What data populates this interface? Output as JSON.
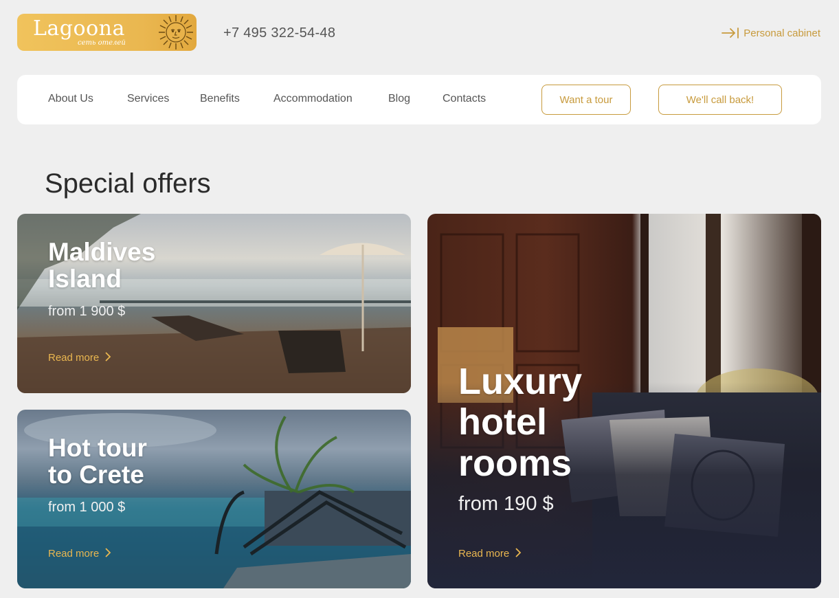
{
  "header": {
    "logo_name": "Lagoona",
    "logo_sub": "сеть отелей",
    "phone": "+7 495 322-54-48",
    "cabinet_label": "Personal cabinet",
    "cabinet_icon": "login-icon"
  },
  "nav": {
    "items": [
      "About Us",
      "Services",
      "Benefits",
      "Accommodation",
      "Blog",
      "Contacts"
    ],
    "tour_button": "Want a tour",
    "callback_button": "We'll call back!"
  },
  "section": {
    "title": "Special offers"
  },
  "offers": [
    {
      "title_line1": "Maldives",
      "title_line2": "Island",
      "price": "from 1 900 $",
      "link": "Read more"
    },
    {
      "title_line1": "Hot tour",
      "title_line2": "to Crete",
      "price": "from 1 000 $",
      "link": "Read more"
    },
    {
      "title_line1": "Luxury",
      "title_line2": "hotel",
      "title_line3": "rooms",
      "price": "from 190 $",
      "link": "Read more"
    }
  ],
  "colors": {
    "accent": "#c79a3c",
    "logo_bg": "#eab750",
    "background": "#efefef"
  }
}
